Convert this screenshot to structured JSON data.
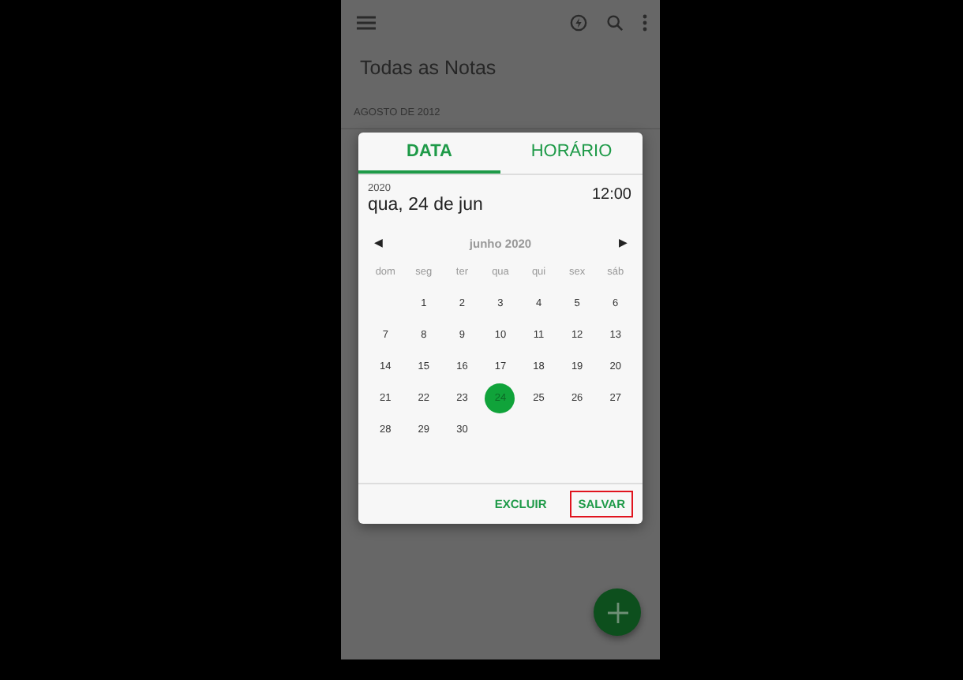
{
  "app_bar": {
    "title": "Todas as Notas"
  },
  "section_header": "AGOSTO DE 2012",
  "date_picker": {
    "tabs": [
      {
        "label": "DATA",
        "selected": true
      },
      {
        "label": "HORÁRIO",
        "selected": false
      }
    ],
    "year": "2020",
    "date": "qua, 24 de jun",
    "time": "12:00",
    "prev": "◀",
    "month": "junho 2020",
    "next": "▶",
    "weekdays": [
      "dom",
      "seg",
      "ter",
      "qua",
      "qui",
      "sex",
      "sáb"
    ],
    "weeks": [
      [
        {
          "day": "1",
          "selected": false
        },
        {
          "day": "2",
          "selected": false
        },
        {
          "day": "3",
          "selected": false
        },
        {
          "day": "4",
          "selected": false
        },
        {
          "day": "5",
          "selected": false
        },
        {
          "day": "6",
          "selected": false
        }
      ],
      [
        {
          "day": "7",
          "selected": false
        },
        {
          "day": "8",
          "selected": false
        },
        {
          "day": "9",
          "selected": false
        },
        {
          "day": "10",
          "selected": false
        },
        {
          "day": "11",
          "selected": false
        },
        {
          "day": "12",
          "selected": false
        },
        {
          "day": "13",
          "selected": false
        }
      ],
      [
        {
          "day": "14",
          "selected": false
        },
        {
          "day": "15",
          "selected": false
        },
        {
          "day": "16",
          "selected": false
        },
        {
          "day": "17",
          "selected": false
        },
        {
          "day": "18",
          "selected": false
        },
        {
          "day": "19",
          "selected": false
        },
        {
          "day": "20",
          "selected": false
        }
      ],
      [
        {
          "day": "21",
          "selected": false
        },
        {
          "day": "22",
          "selected": false
        },
        {
          "day": "23",
          "selected": false
        },
        {
          "day": "24",
          "selected": true
        },
        {
          "day": "25",
          "selected": false
        },
        {
          "day": "26",
          "selected": false
        },
        {
          "day": "27",
          "selected": false
        }
      ],
      [
        {
          "day": "28",
          "selected": false
        },
        {
          "day": "29",
          "selected": false
        },
        {
          "day": "30",
          "selected": false
        }
      ]
    ],
    "buttons": [
      {
        "label": "EXCLUIR",
        "highlighted": false
      },
      {
        "label": "SALVAR",
        "highlighted": true
      }
    ]
  }
}
